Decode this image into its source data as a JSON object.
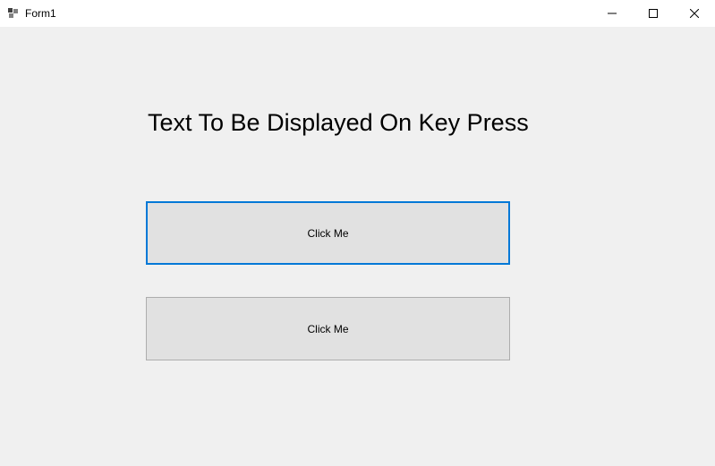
{
  "window": {
    "title": "Form1"
  },
  "content": {
    "heading": "Text To Be Displayed On Key Press",
    "button1_label": "Click Me",
    "button2_label": "Click Me"
  }
}
